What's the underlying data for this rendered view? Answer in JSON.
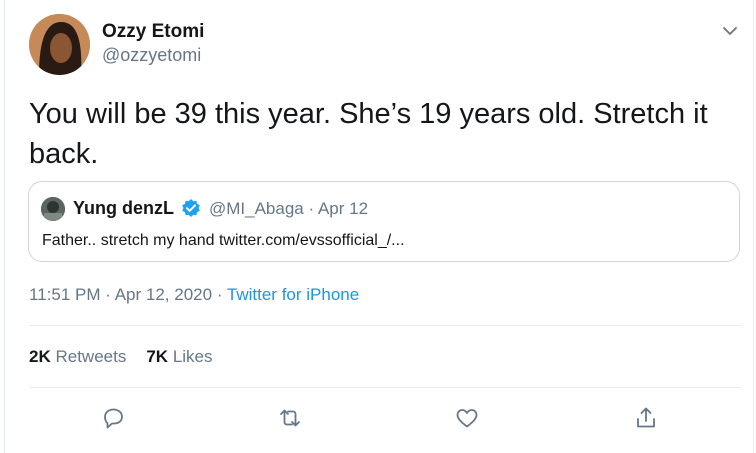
{
  "tweet": {
    "author_name": "Ozzy Etomi",
    "author_handle": "@ozzyetomi",
    "text": "You will be 39 this year. She’s 19 years old. Stretch it back.",
    "quoted": {
      "author_name": "Yung denzL",
      "author_handle": "@MI_Abaga",
      "separator": "·",
      "date": "Apr 12",
      "text": "Father.. stretch my hand twitter.com/evssofficial_/..."
    },
    "time": "11:51 PM",
    "date": "Apr 12, 2020",
    "separator": "·",
    "source": "Twitter for iPhone",
    "retweets_count": "2K",
    "retweets_label": "Retweets",
    "likes_count": "7K",
    "likes_label": "Likes"
  },
  "colors": {
    "text": "#14171a",
    "secondary": "#657786",
    "link": "#1b95e0",
    "verified": "#1da1f2",
    "border": "#e6ecf0"
  },
  "icons": [
    "chevron-down-icon",
    "verified-badge-icon",
    "reply-icon",
    "retweet-icon",
    "like-icon",
    "share-icon"
  ]
}
